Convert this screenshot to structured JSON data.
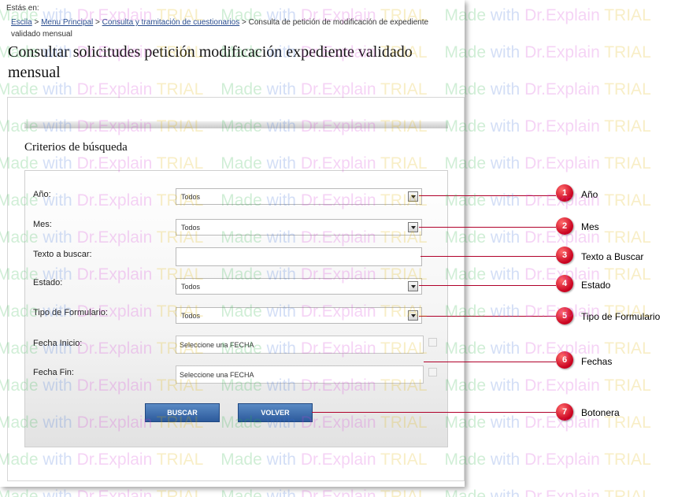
{
  "breadcrumb": {
    "label": "Estás en:",
    "links": [
      "Escila",
      "Menu Principal",
      "Consulta y tramitación de cuestionarios"
    ],
    "separator": ">",
    "current": "Consulta de petición de modificación de expediente validado mensual"
  },
  "page_title": "Consultar solicitudes petición modificación expediente validado mensual",
  "section_title": "Criterios de búsqueda",
  "form": {
    "anio": {
      "label": "Año:",
      "value": "Todos"
    },
    "mes": {
      "label": "Mes:",
      "value": "Todos"
    },
    "texto": {
      "label": "Texto a buscar:",
      "value": ""
    },
    "estado": {
      "label": "Estado:",
      "value": "Todos"
    },
    "tipo": {
      "label": "Tipo de Formulario:",
      "value": "Todos"
    },
    "fecha_inicio": {
      "label": "Fecha Inicio:",
      "value": "Seleccione una FECHA"
    },
    "fecha_fin": {
      "label": "Fecha Fin:",
      "value": "Seleccione una FECHA"
    }
  },
  "buttons": {
    "buscar": "BUSCAR",
    "volver": "VOLVER"
  },
  "callouts": [
    {
      "num": "1",
      "text": "Año"
    },
    {
      "num": "2",
      "text": "Mes"
    },
    {
      "num": "3",
      "text": "Texto a Buscar"
    },
    {
      "num": "4",
      "text": "Estado"
    },
    {
      "num": "5",
      "text": "Tipo de Formulario"
    },
    {
      "num": "6",
      "text": "Fechas"
    },
    {
      "num": "7",
      "text": "Botonera"
    }
  ],
  "watermark": {
    "made": "Made",
    "with": "with",
    "brand": "Dr.Explain",
    "trial": "TRIAL"
  },
  "colors": {
    "callout": "#c8001e",
    "button": "#3d6daf",
    "link": "#2a4d8f"
  }
}
